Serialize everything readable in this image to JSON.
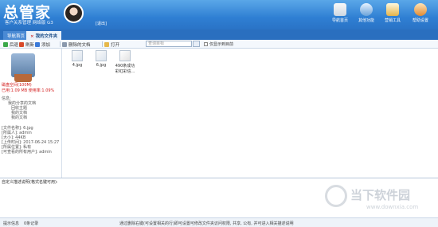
{
  "app": {
    "logo": "总管家",
    "subtitle": "客户关系管理 网络版 G3",
    "logout": "[退出]"
  },
  "top_tools": [
    {
      "label": "导航首页",
      "icon": "home-icon"
    },
    {
      "label": "其他功能",
      "icon": "settings-icon"
    },
    {
      "label": "营销工具",
      "icon": "wand-icon"
    },
    {
      "label": "帮助设置",
      "icon": "help-icon"
    }
  ],
  "tabs": {
    "home": "导航首页",
    "active": "我的文件夹",
    "close": "×"
  },
  "toolbar": {
    "back": "后退",
    "refresh": "刷新",
    "add": "添加",
    "deleted": "删除的文档",
    "open": "打开",
    "search_placeholder": "查询目标",
    "checkbox_label": "仅显示到目前"
  },
  "left": {
    "capacity_title": "磁盘空间(100M)",
    "capacity_used": "已用:1.09 MB 使用率:1.09%",
    "tree_title": "信息:",
    "tree_items": [
      "我的分享的文档",
      "回收主题",
      "我的文档",
      "我的文档"
    ],
    "info_lines": [
      "[文件名称]: 6.jpg",
      "[所属人]: admin",
      "[大小]: 44KB",
      "[上传时间]: 2017-06-24 15:27",
      "[所属位置]: 私有",
      "[可查看的所有用户]: admin"
    ]
  },
  "files": [
    {
      "name": "4.jpg",
      "icon": "image-file-icon"
    },
    {
      "name": "6.jpg",
      "icon": "image-file-icon"
    },
    {
      "name": "490条成功 彩虹彩信...",
      "icon": "doc-file-icon"
    }
  ],
  "desc": {
    "label": "自定义描述说明(格式名键可用):"
  },
  "status": {
    "hint": "提示信息",
    "count": "0条记录",
    "tip": "通过删除右键(可设置相关的行)即可设置可修改文件夹访问权限, 共享, 公有, 并可进入相关描述说明"
  },
  "watermark": {
    "text": "当下软件园",
    "url": "www.downxia.com"
  }
}
